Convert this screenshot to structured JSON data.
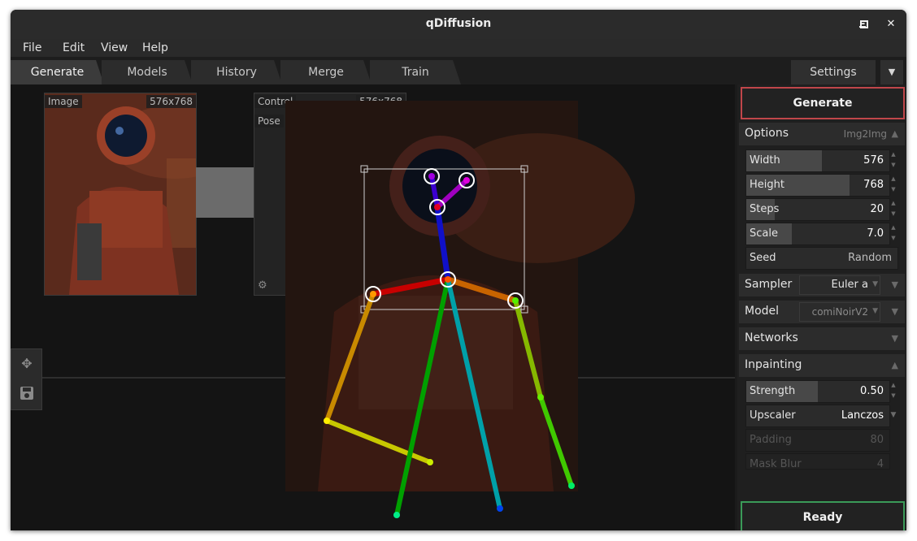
{
  "window": {
    "title": "qDiffusion"
  },
  "menu": [
    "File",
    "Edit",
    "View",
    "Help"
  ],
  "tabs": [
    "Generate",
    "Models",
    "History",
    "Merge",
    "Train"
  ],
  "settings_tab": "Settings",
  "nodes": {
    "image": {
      "label": "Image",
      "size": "576x768"
    },
    "control": {
      "label": "Control",
      "size": "576x768",
      "type": "Pose"
    }
  },
  "right": {
    "generate": "Generate",
    "options": {
      "label": "Options",
      "mode": "Img2Img"
    },
    "fields": [
      {
        "label": "Width",
        "value": "576",
        "fill": 0.47
      },
      {
        "label": "Height",
        "value": "768",
        "fill": 0.72
      },
      {
        "label": "Steps",
        "value": "20",
        "fill": 0.2
      },
      {
        "label": "Scale",
        "value": "7.0",
        "fill": 0.33
      },
      {
        "label": "Seed",
        "value": "Random",
        "fill": 0
      }
    ],
    "sampler": {
      "label": "Sampler",
      "value": "Euler a"
    },
    "model": {
      "label": "Model",
      "value": "comiNoirV2"
    },
    "networks": {
      "label": "Networks"
    },
    "inpainting": {
      "label": "Inpainting"
    },
    "inpaint_fields": [
      {
        "label": "Strength",
        "value": "0.50",
        "fill": 0.5
      },
      {
        "label": "Upscaler",
        "value": "Lanczos",
        "fill": 0
      },
      {
        "label": "Padding",
        "value": "80",
        "fill": 0
      },
      {
        "label": "Mask Blur",
        "value": "4",
        "fill": 0
      }
    ],
    "status": "Ready"
  },
  "colors": {
    "generate_border": "#c0464a",
    "ready_border": "#3a9a58",
    "bg": "#1b1b1b",
    "accent": "#484848"
  }
}
